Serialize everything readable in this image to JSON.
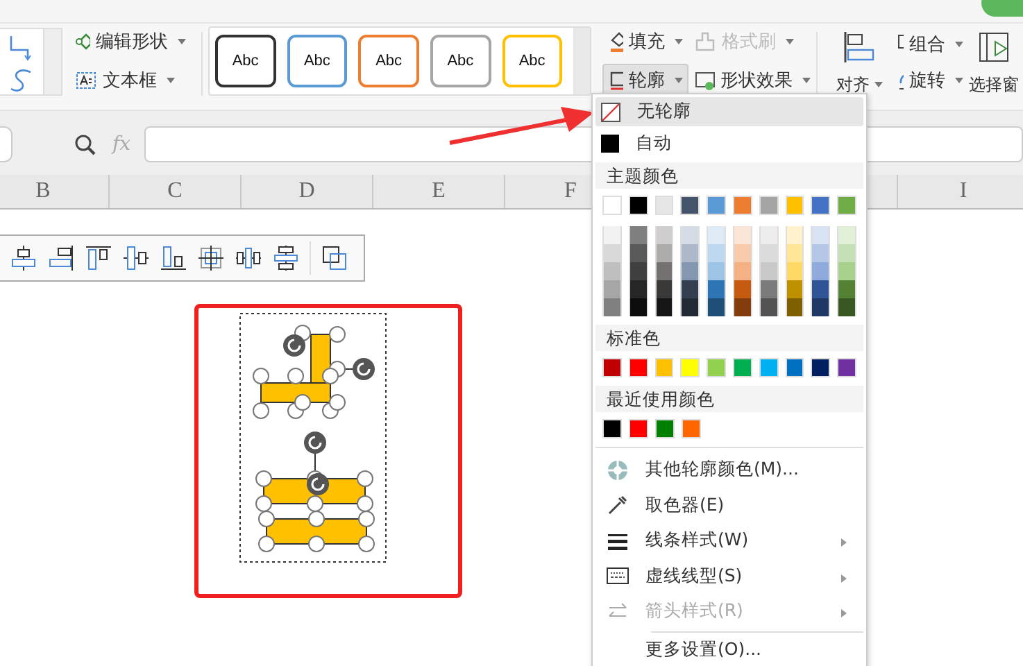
{
  "ribbon": {
    "shape_tools": [
      {
        "kind": "edit-shape",
        "label": "编辑形状"
      },
      {
        "kind": "text-box",
        "label": "文本框"
      }
    ],
    "style_presets": [
      {
        "label": "Abc",
        "color": "#333333"
      },
      {
        "label": "Abc",
        "color": "#5b9bd5"
      },
      {
        "label": "Abc",
        "color": "#ed7d31"
      },
      {
        "label": "Abc",
        "color": "#a5a5a5"
      },
      {
        "label": "Abc",
        "color": "#ffc000"
      }
    ],
    "format_buttons": [
      {
        "kind": "fill",
        "label": "填充",
        "disabled": false,
        "pressed": false
      },
      {
        "kind": "painter",
        "label": "格式刷",
        "disabled": true,
        "pressed": false
      },
      {
        "kind": "outline",
        "label": "轮廓",
        "disabled": false,
        "pressed": true
      },
      {
        "kind": "effects",
        "label": "形状效果",
        "disabled": false,
        "pressed": false
      }
    ],
    "arrange_buttons": [
      {
        "kind": "align",
        "label": "对齐"
      },
      {
        "kind": "group",
        "label": "组合"
      },
      {
        "kind": "rotate",
        "label": "旋转"
      },
      {
        "kind": "pane",
        "label": "选择窗"
      }
    ]
  },
  "formula_bar": {
    "fx": "fx"
  },
  "column_headers": [
    "B",
    "C",
    "D",
    "E",
    "F",
    "I"
  ],
  "outline_menu": {
    "items": [
      {
        "kind": "no-outline",
        "label": "无轮廓",
        "highlighted": true
      },
      {
        "kind": "auto",
        "label": "自动",
        "highlighted": false
      }
    ],
    "theme_title": "主题颜色",
    "theme_colors": [
      {
        "color": "#ffffff"
      },
      {
        "color": "#000000"
      },
      {
        "color": "#e7e6e6"
      },
      {
        "color": "#44546a"
      },
      {
        "color": "#5b9bd5"
      },
      {
        "color": "#ed7d31"
      },
      {
        "color": "#a5a5a5"
      },
      {
        "color": "#ffc000"
      },
      {
        "color": "#4472c4"
      },
      {
        "color": "#70ad47"
      }
    ],
    "theme_shades": [
      {
        "swatches": [
          {
            "color": "#f2f2f2"
          },
          {
            "color": "#7f7f7f"
          },
          {
            "color": "#d0cece"
          },
          {
            "color": "#d6dce5"
          },
          {
            "color": "#deebf7"
          },
          {
            "color": "#fbe5d6"
          },
          {
            "color": "#ededed"
          },
          {
            "color": "#fff2cc"
          },
          {
            "color": "#dae3f3"
          },
          {
            "color": "#e2f0d9"
          }
        ]
      },
      {
        "swatches": [
          {
            "color": "#d9d9d9"
          },
          {
            "color": "#595959"
          },
          {
            "color": "#aeabab"
          },
          {
            "color": "#adb9ca"
          },
          {
            "color": "#bdd7ee"
          },
          {
            "color": "#f8cbad"
          },
          {
            "color": "#dbdbdb"
          },
          {
            "color": "#ffe699"
          },
          {
            "color": "#b4c7e7"
          },
          {
            "color": "#c5e0b4"
          }
        ]
      },
      {
        "swatches": [
          {
            "color": "#bfbfbf"
          },
          {
            "color": "#404040"
          },
          {
            "color": "#767171"
          },
          {
            "color": "#8497b0"
          },
          {
            "color": "#9dc3e6"
          },
          {
            "color": "#f4b183"
          },
          {
            "color": "#c9c9c9"
          },
          {
            "color": "#ffd966"
          },
          {
            "color": "#8faadc"
          },
          {
            "color": "#a9d18e"
          }
        ]
      },
      {
        "swatches": [
          {
            "color": "#a6a6a6"
          },
          {
            "color": "#262626"
          },
          {
            "color": "#3b3838"
          },
          {
            "color": "#333f50"
          },
          {
            "color": "#2e75b6"
          },
          {
            "color": "#c55a11"
          },
          {
            "color": "#7b7b7b"
          },
          {
            "color": "#bf9000"
          },
          {
            "color": "#2f5597"
          },
          {
            "color": "#548235"
          }
        ]
      },
      {
        "swatches": [
          {
            "color": "#808080"
          },
          {
            "color": "#0d0d0d"
          },
          {
            "color": "#171616"
          },
          {
            "color": "#222a35"
          },
          {
            "color": "#1f4e79"
          },
          {
            "color": "#843c0c"
          },
          {
            "color": "#525252"
          },
          {
            "color": "#7f6000"
          },
          {
            "color": "#203864"
          },
          {
            "color": "#385723"
          }
        ]
      }
    ],
    "standard_title": "标准色",
    "standard_colors": [
      {
        "color": "#c00000"
      },
      {
        "color": "#ff0000"
      },
      {
        "color": "#ffc000"
      },
      {
        "color": "#ffff00"
      },
      {
        "color": "#92d050"
      },
      {
        "color": "#00b050"
      },
      {
        "color": "#00b0f0"
      },
      {
        "color": "#0070c0"
      },
      {
        "color": "#002060"
      },
      {
        "color": "#7030a0"
      }
    ],
    "recent_title": "最近使用颜色",
    "recent_colors": [
      {
        "color": "#000000"
      },
      {
        "color": "#ff0000"
      },
      {
        "color": "#008000"
      },
      {
        "color": "#ff6600"
      }
    ],
    "commands": [
      {
        "kind": "more-colors",
        "label": "其他轮廓颜色(M)...",
        "submenu": false,
        "disabled": false
      },
      {
        "kind": "eyedropper",
        "label": "取色器(E)",
        "submenu": false,
        "disabled": false
      },
      {
        "kind": "line-style",
        "label": "线条样式(W)",
        "submenu": true,
        "disabled": false
      },
      {
        "kind": "dash-style",
        "label": "虚线线型(S)",
        "submenu": true,
        "disabled": false
      },
      {
        "kind": "arrow-style",
        "label": "箭头样式(R)",
        "submenu": true,
        "disabled": true
      }
    ],
    "footer_commands": [
      {
        "label": "更多设置(O)...",
        "submenu": false,
        "disabled": false
      }
    ]
  }
}
